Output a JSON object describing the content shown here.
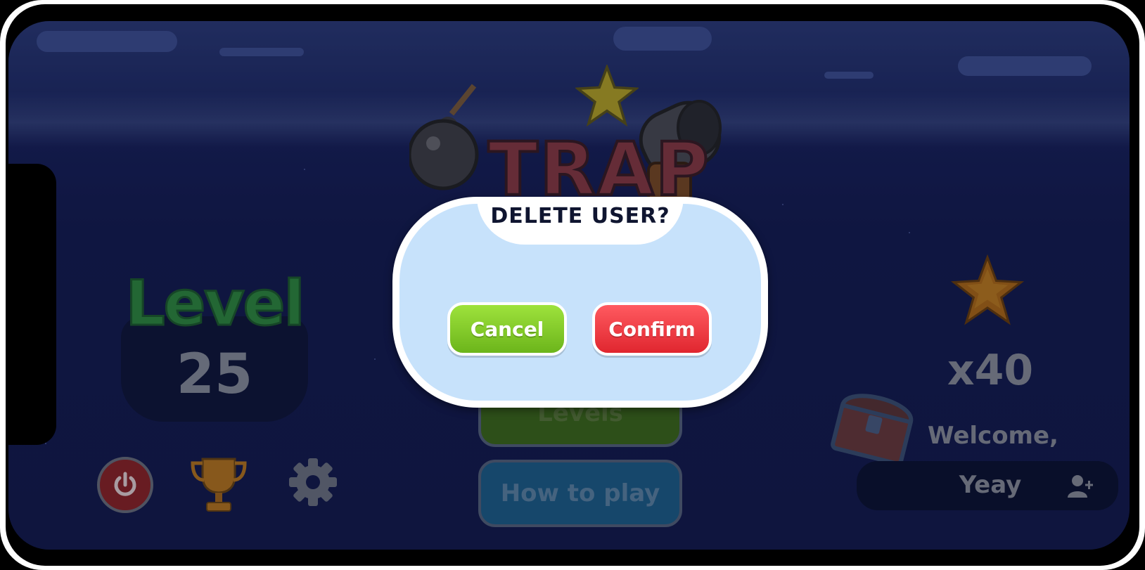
{
  "game": {
    "logo_text": "TRAP"
  },
  "level": {
    "label": "Level",
    "number": "25"
  },
  "menu": {
    "levels_label": "Levels",
    "how_to_play_label": "How to play"
  },
  "stats": {
    "star_count": "x40"
  },
  "user": {
    "welcome_label": "Welcome,",
    "name": "Yeay"
  },
  "dialog": {
    "title": "DELETE USER?",
    "cancel_label": "Cancel",
    "confirm_label": "Confirm"
  },
  "icons": [
    "power-icon",
    "trophy-icon",
    "gear-icon",
    "star-icon",
    "chest-icon",
    "add-user-icon",
    "bomb-icon",
    "cannon-icon"
  ],
  "colors": {
    "cancel": "#7cc520",
    "confirm": "#f0363e",
    "dialog_bg": "#c7e2fb",
    "sky": "#131b4f"
  }
}
